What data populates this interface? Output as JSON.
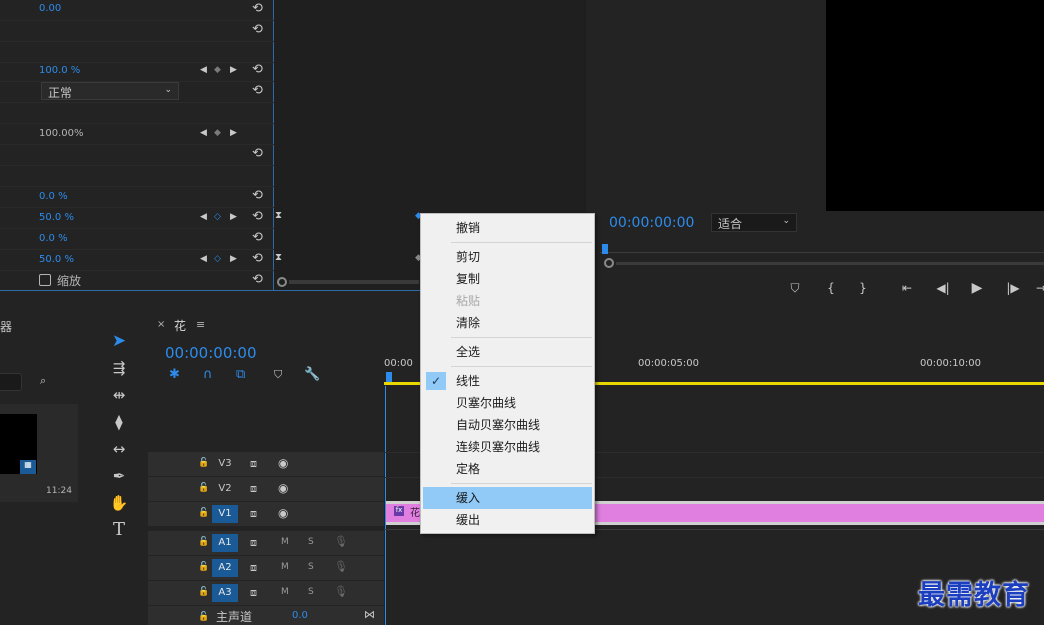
{
  "effect_controls": {
    "rows": [
      {
        "value": "0.00",
        "color": "blue"
      },
      {
        "value": "",
        "color": "blue"
      },
      {
        "value": "",
        "color": "blue"
      },
      {
        "value": "100.0 %",
        "color": "blue"
      },
      {
        "value": "",
        "color": "blue",
        "dropdown": "正常"
      },
      {
        "value": "",
        "color": "blue"
      },
      {
        "value": "100.00%",
        "color": "white"
      },
      {
        "value": "",
        "color": "blue"
      },
      {
        "value": "",
        "color": "blue"
      },
      {
        "value": "0.0 %",
        "color": "blue"
      },
      {
        "value": "50.0 %",
        "color": "blue"
      },
      {
        "value": "0.0 %",
        "color": "blue"
      },
      {
        "value": "50.0 %",
        "color": "blue"
      },
      {
        "value": "缩放",
        "color": "white",
        "checkbox": true
      }
    ],
    "blend_mode": "正常"
  },
  "program_monitor": {
    "timecode": "00:00:00:00",
    "fit": "适合"
  },
  "project_panel": {
    "thumb_duration": "11:24"
  },
  "timeline": {
    "sequence_name": "花",
    "timecode": "00:00:00:00",
    "ruler": [
      "00:00",
      "00:00:05:00",
      "00:00:10:00"
    ],
    "clip_label": "花",
    "video_tracks": [
      "V3",
      "V2",
      "V1"
    ],
    "audio_tracks": [
      "A1",
      "A2",
      "A3"
    ],
    "master": {
      "label": "主声道",
      "value": "0.0"
    },
    "mute": "M",
    "solo": "S"
  },
  "context_menu": {
    "items": [
      "撤销",
      "剪切",
      "复制",
      "粘贴",
      "清除",
      "全选",
      "线性",
      "贝塞尔曲线",
      "自动贝塞尔曲线",
      "连续贝塞尔曲线",
      "定格",
      "缓入",
      "缓出"
    ]
  },
  "watermark": "最需教育",
  "colors": {
    "accent": "#2d8ceb",
    "clip": "#e07fe0",
    "playhead_bar": "#e8d800",
    "menu_highlight": "#91c9f7"
  }
}
